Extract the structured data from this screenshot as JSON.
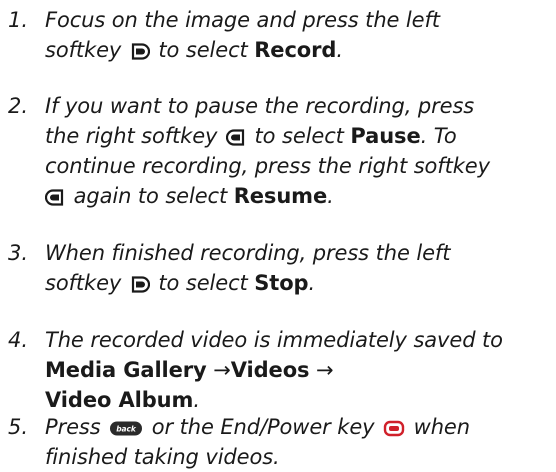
{
  "steps": [
    {
      "number": "1.",
      "line1_pre": "Focus on the image and press the left",
      "line2_pre": "softkey",
      "line2_mid": "to select",
      "line2_bold": "Record",
      "line2_end": "."
    },
    {
      "number": "2.",
      "line1_pre": "If you want to pause the recording, press",
      "line2_pre": "the right softkey",
      "line2_mid": "to select",
      "line2_bold": "Pause",
      "line2_end": ". To",
      "line3": "continue recording, press the right softkey",
      "line4_mid": "again to select",
      "line4_bold": "Resume",
      "line4_end": "."
    },
    {
      "number": "3.",
      "line1_pre": "When finished recording, press the left",
      "line2_pre": "softkey",
      "line2_mid": "to select",
      "line2_bold": "Stop",
      "line2_end": "."
    },
    {
      "number": "4.",
      "line1_pre": "The recorded video is immediately saved to",
      "line2_bold1": "Media Gallery",
      "line2_arrow1": "→",
      "line2_bold2": "Videos",
      "line2_arrow2": "→",
      "line3_bold": "Video Album",
      "line3_end": "."
    },
    {
      "number": "5.",
      "line1_pre": "Press",
      "line1_mid": "or the End/Power key",
      "line1_end": "when",
      "line2": "finished taking videos."
    }
  ],
  "icons": {
    "left_softkey": "left-softkey-icon",
    "right_softkey": "right-softkey-icon",
    "back_key": "back-key-icon",
    "back_key_label": "back",
    "end_power_key": "end-power-key-icon",
    "end_power_color": "#d0202a"
  }
}
